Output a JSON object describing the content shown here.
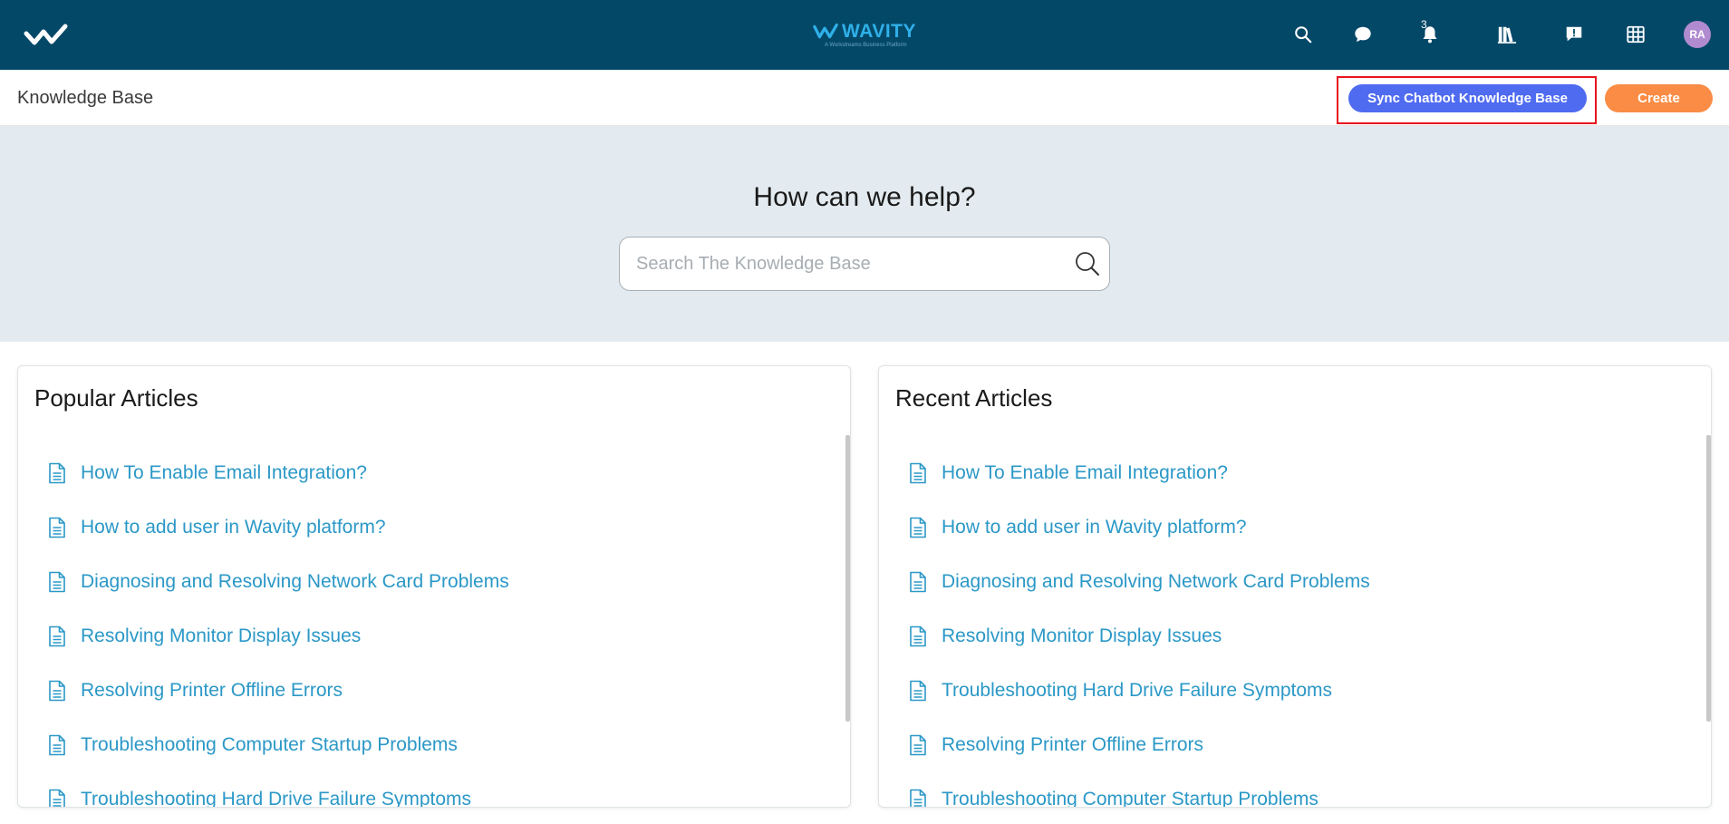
{
  "topbar": {
    "brand_name": "WAVITY",
    "brand_tagline": "A Workstreams Business Platform",
    "notification_count": "3",
    "avatar_initials": "RA",
    "icons": [
      "logo-check-icon",
      "search-icon",
      "chat-icon",
      "bell-icon",
      "library-icon",
      "feedback-icon",
      "apps-grid-icon"
    ],
    "colors": {
      "bar": "#044868",
      "brand": "#2fb0e8"
    }
  },
  "header": {
    "title": "Knowledge Base",
    "sync_button": "Sync Chatbot Knowledge Base",
    "create_button": "Create",
    "colors": {
      "sync": "#4f6bf0",
      "create": "#fa8c45",
      "highlight": "#e8141e"
    }
  },
  "hero": {
    "heading": "How can we help?",
    "search_placeholder": "Search The Knowledge Base"
  },
  "popular": {
    "title": "Popular Articles",
    "items": [
      "How To Enable Email Integration?",
      "How to add user in Wavity platform?",
      "Diagnosing and Resolving Network Card Problems",
      "Resolving Monitor Display Issues",
      "Resolving Printer Offline Errors",
      "Troubleshooting Computer Startup Problems",
      "Troubleshooting Hard Drive Failure Symptoms"
    ]
  },
  "recent": {
    "title": "Recent Articles",
    "items": [
      "How To Enable Email Integration?",
      "How to add user in Wavity platform?",
      "Diagnosing and Resolving Network Card Problems",
      "Resolving Monitor Display Issues",
      "Troubleshooting Hard Drive Failure Symptoms",
      "Resolving Printer Offline Errors",
      "Troubleshooting Computer Startup Problems"
    ]
  }
}
